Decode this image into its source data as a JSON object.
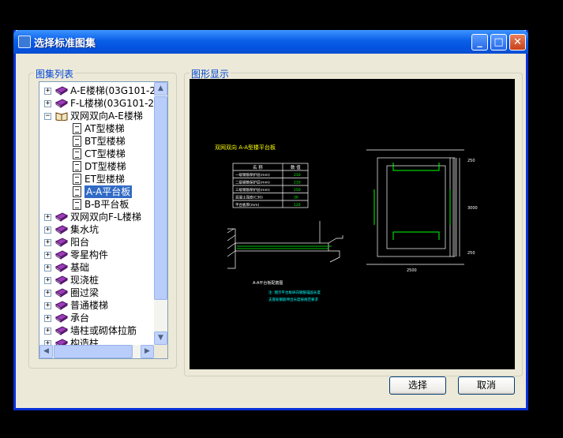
{
  "window": {
    "title": "选择标准图集",
    "min_icon": "minimize-icon",
    "max_icon": "maximize-icon",
    "close_icon": "close-icon"
  },
  "left_group": {
    "label": "图集列表"
  },
  "right_group": {
    "label": "图形显示"
  },
  "tree": [
    {
      "label": "A-E楼梯(03G101-2)",
      "level": 0,
      "expanded": false,
      "icon": "book-icon"
    },
    {
      "label": "F-L楼梯(03G101-2)",
      "level": 0,
      "expanded": false,
      "icon": "book-icon"
    },
    {
      "label": "双网双向A-E楼梯",
      "level": 0,
      "expanded": true,
      "icon": "open-book-icon"
    },
    {
      "label": "AT型楼梯",
      "level": 1,
      "icon": "document-icon"
    },
    {
      "label": "BT型楼梯",
      "level": 1,
      "icon": "document-icon"
    },
    {
      "label": "CT型楼梯",
      "level": 1,
      "icon": "document-icon"
    },
    {
      "label": "DT型楼梯",
      "level": 1,
      "icon": "document-icon"
    },
    {
      "label": "ET型楼梯",
      "level": 1,
      "icon": "document-icon"
    },
    {
      "label": "A-A平台板",
      "level": 1,
      "icon": "document-icon",
      "selected": true
    },
    {
      "label": "B-B平台板",
      "level": 1,
      "icon": "document-icon"
    },
    {
      "label": "双网双向F-L楼梯",
      "level": 0,
      "expanded": false,
      "icon": "book-icon"
    },
    {
      "label": "集水坑",
      "level": 0,
      "expanded": false,
      "icon": "book-icon"
    },
    {
      "label": "阳台",
      "level": 0,
      "expanded": false,
      "icon": "book-icon"
    },
    {
      "label": "零星构件",
      "level": 0,
      "expanded": false,
      "icon": "book-icon"
    },
    {
      "label": "基础",
      "level": 0,
      "expanded": false,
      "icon": "book-icon"
    },
    {
      "label": "现浇桩",
      "level": 0,
      "expanded": false,
      "icon": "book-icon"
    },
    {
      "label": "圈过梁",
      "level": 0,
      "expanded": false,
      "icon": "book-icon"
    },
    {
      "label": "普通楼梯",
      "level": 0,
      "expanded": false,
      "icon": "book-icon"
    },
    {
      "label": "承台",
      "level": 0,
      "expanded": false,
      "icon": "book-icon"
    },
    {
      "label": "墙柱或砌体拉筋",
      "level": 0,
      "expanded": false,
      "icon": "book-icon"
    },
    {
      "label": "构造柱",
      "level": 0,
      "expanded": false,
      "icon": "book-icon"
    }
  ],
  "drawing": {
    "heading": "双网双向 A-A型楼平台板",
    "table_headers": [
      "名 称",
      "数 值"
    ],
    "table_rows": [
      [
        "一级钢筋保护层(mm)",
        "210"
      ],
      [
        "二级钢筋保护层(mm)",
        "210"
      ],
      [
        "三级钢筋保护层(mm)",
        "150"
      ],
      [
        "混凝土强度(C30)",
        "30"
      ],
      [
        "平台板厚(mm)",
        "120"
      ]
    ],
    "section_caption": "A-A平台板配筋图",
    "notes": [
      "注: 图示平台板纵向钢筋锚固长度",
      "支座处钢筋伸出长度按规范要求"
    ],
    "plan_dims": [
      "250",
      "3000",
      "250",
      "2500"
    ],
    "colors": {
      "line": "#ffffff",
      "accent": "#00ff00",
      "text": "#ffff00",
      "note": "#00ffff"
    }
  },
  "buttons": {
    "select": "选择",
    "cancel": "取消"
  }
}
